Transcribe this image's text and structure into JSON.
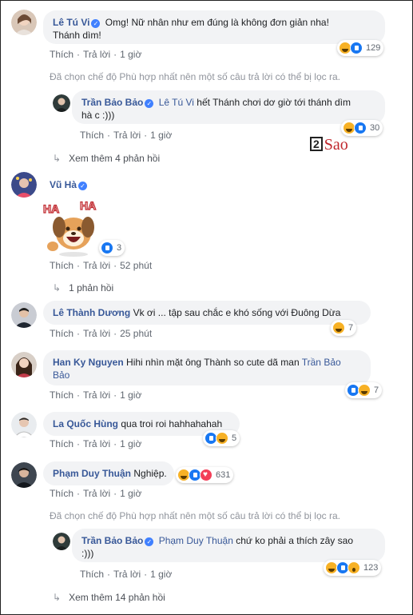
{
  "watermark": {
    "number": "2",
    "text": "Sao"
  },
  "comments": [
    {
      "author": "Lê Tú Vi",
      "verified": true,
      "text_line1": "Omg! Nữ nhân như em đúng là không đơn giản nha!",
      "text_line2": "Thánh dìm!",
      "like": "Thích",
      "reply": "Trả lời",
      "time": "1 giờ",
      "reactions": [
        "haha",
        "like"
      ],
      "reaction_count": "129"
    },
    {
      "notice": "Đã chọn chế độ Phù hợp nhất nên một số câu trả lời có thể bị lọc ra."
    },
    {
      "author": "Trần Bảo Bảo",
      "verified": true,
      "mention": "Lê Tú Vi",
      "text_line1": " hết Thánh chơi dơ giờ tới thánh dìm",
      "text_line2": "hà c :)))",
      "like": "Thích",
      "reply": "Trả lời",
      "time": "1 giờ",
      "reactions": [
        "haha",
        "like"
      ],
      "reaction_count": "30"
    },
    {
      "more": "Xem thêm 4 phản hồi"
    },
    {
      "author": "Vũ Hà",
      "verified": true,
      "sticker": "haha-dog-sticker",
      "like": "Thích",
      "reply": "Trả lời",
      "time": "52 phút",
      "reactions": [
        "like"
      ],
      "reaction_count": "3"
    },
    {
      "more": "1 phản hồi"
    },
    {
      "author": "Lê Thành Dương",
      "text": "Vk ơi ... tập sau chắc e khó sống với Đuông Dừa",
      "like": "Thích",
      "reply": "Trả lời",
      "time": "25 phút",
      "reactions": [
        "haha"
      ],
      "reaction_count": "7"
    },
    {
      "author": "Han Ky Nguyen",
      "text": "Hihi nhìn mặt ông Thành so cute dã man",
      "mention": "Trần Bảo",
      "mention_line2": "Bảo",
      "like": "Thích",
      "reply": "Trả lời",
      "time": "1 giờ",
      "reactions": [
        "like",
        "haha"
      ],
      "reaction_count": "7"
    },
    {
      "author": "La Quốc Hùng",
      "text": "qua troi roi hahhahahah",
      "like": "Thích",
      "reply": "Trả lời",
      "time": "1 giờ",
      "reactions": [
        "like",
        "haha"
      ],
      "reaction_count": "5"
    },
    {
      "author": "Phạm Duy Thuận",
      "text": "Nghiệp.",
      "like": "Thích",
      "reply": "Trả lời",
      "time": "1 giờ",
      "reactions": [
        "haha",
        "like",
        "love"
      ],
      "reaction_count": "631"
    },
    {
      "notice": "Đã chọn chế độ Phù hợp nhất nên một số câu trả lời có thể bị lọc ra."
    },
    {
      "author": "Trần Bảo Bảo",
      "verified": true,
      "mention": "Phạm Duy Thuận",
      "text_line1": " chứ ko phải a thích zây sao",
      "text_line2": ":)))",
      "like": "Thích",
      "reply": "Trả lời",
      "time": "1 giờ",
      "reactions": [
        "haha",
        "like",
        "wow"
      ],
      "reaction_count": "123"
    },
    {
      "more": "Xem thêm 14 phản hồi"
    }
  ],
  "colors": {
    "link": "#385898",
    "bubble": "#f2f3f5",
    "like": "#1877f2",
    "haha": "#f7b125",
    "love": "#f33e58"
  }
}
